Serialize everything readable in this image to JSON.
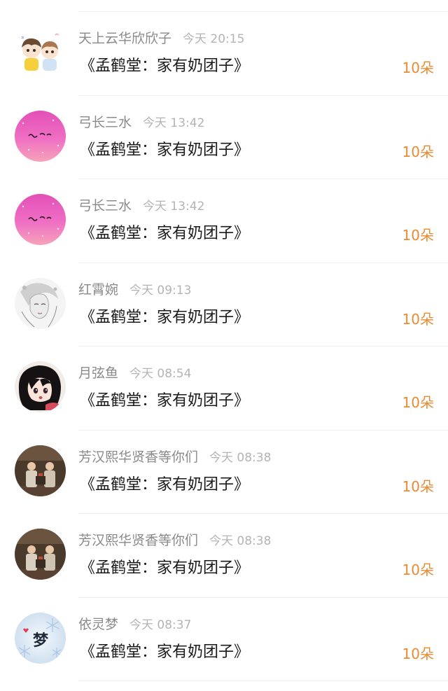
{
  "gift_list": {
    "accent_color": "#ec8a32",
    "items": [
      {
        "user_name": "天上云华欣欣子",
        "time": "今天 20:15",
        "gift_title": "《孟鹤堂：家有奶团子》",
        "count": "10朵",
        "avatar_icon": "cartoon-couple-avatar-icon"
      },
      {
        "user_name": "弓长三水",
        "time": "今天 13:42",
        "gift_title": "《孟鹤堂：家有奶团子》",
        "count": "10朵",
        "avatar_icon": "pink-glitter-avatar-icon"
      },
      {
        "user_name": "弓长三水",
        "time": "今天 13:42",
        "gift_title": "《孟鹤堂：家有奶团子》",
        "count": "10朵",
        "avatar_icon": "pink-glitter-avatar-icon"
      },
      {
        "user_name": "红霄婉",
        "time": "今天 09:13",
        "gift_title": "《孟鹤堂：家有奶团子》",
        "count": "10朵",
        "avatar_icon": "sketch-portrait-avatar-icon"
      },
      {
        "user_name": "月弦鱼",
        "time": "今天 08:54",
        "gift_title": "《孟鹤堂：家有奶团子》",
        "count": "10朵",
        "avatar_icon": "anime-girl-avatar-icon"
      },
      {
        "user_name": "芳汉熙华贤香等你们",
        "time": "今天 08:38",
        "gift_title": "《孟鹤堂：家有奶团子》",
        "count": "10朵",
        "avatar_icon": "stage-performers-avatar-icon"
      },
      {
        "user_name": "芳汉熙华贤香等你们",
        "time": "今天 08:38",
        "gift_title": "《孟鹤堂：家有奶团子》",
        "count": "10朵",
        "avatar_icon": "stage-performers-avatar-icon"
      },
      {
        "user_name": "依灵梦",
        "time": "今天 08:37",
        "gift_title": "《孟鹤堂：家有奶团子》",
        "count": "10朵",
        "avatar_icon": "snowflake-dream-avatar-icon",
        "avatar_text": "梦"
      }
    ]
  }
}
